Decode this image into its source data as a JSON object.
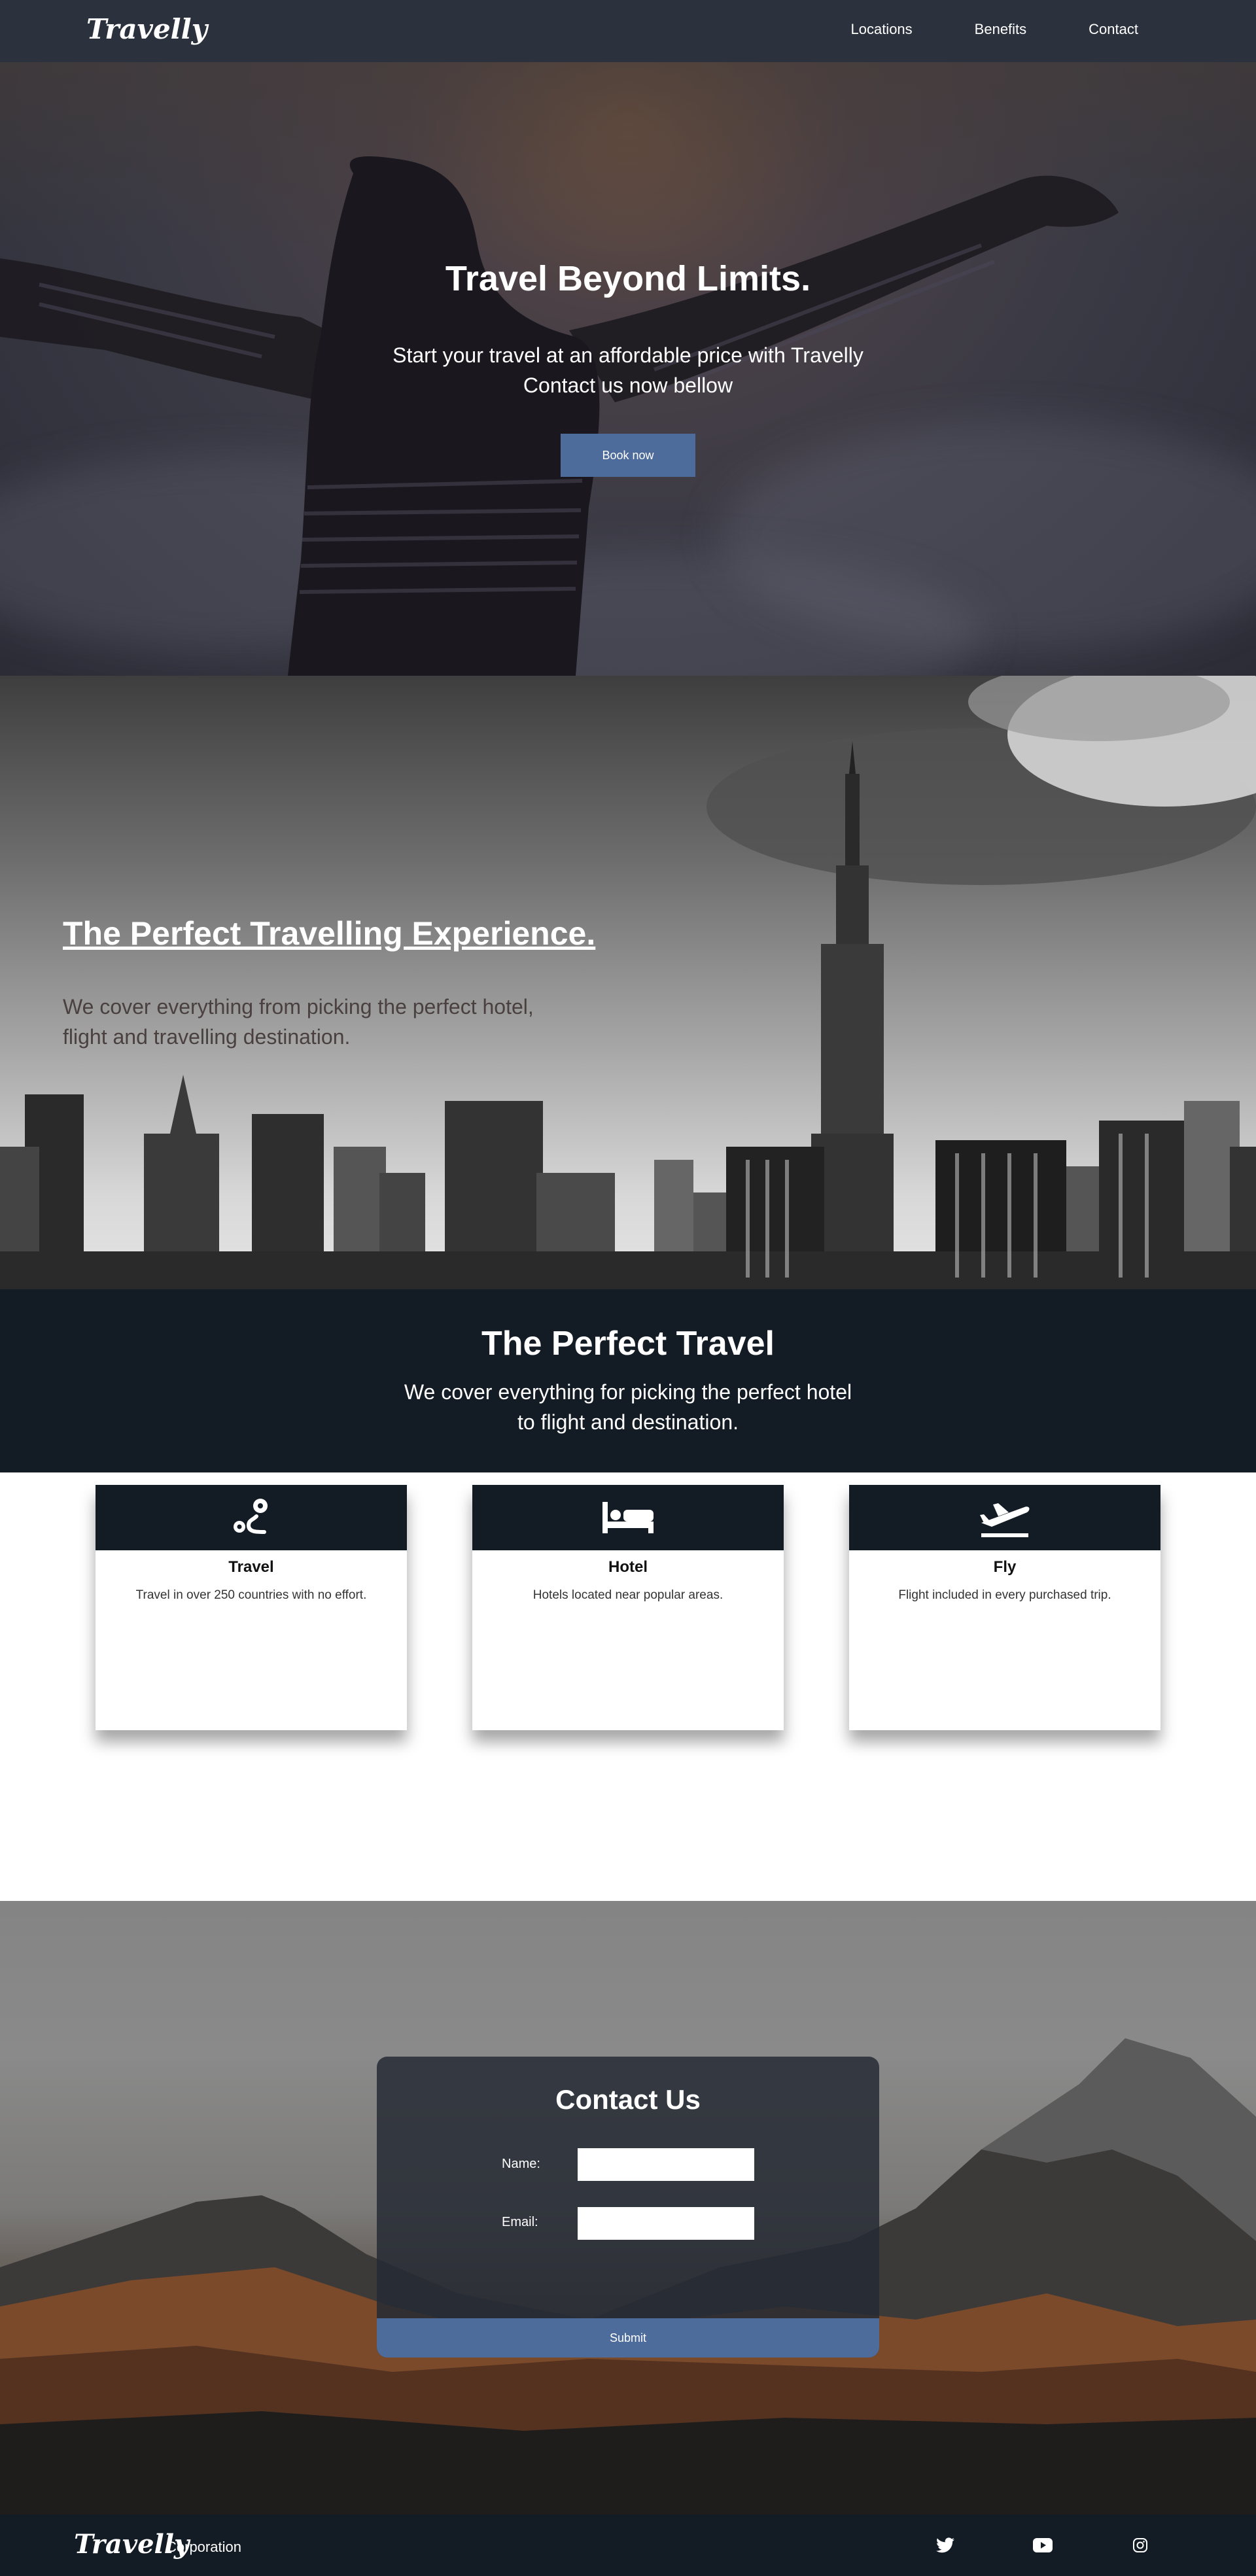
{
  "nav": {
    "logo": "Travelly",
    "links": [
      "Locations",
      "Benefits",
      "Contact"
    ]
  },
  "hero": {
    "title": "Travel Beyond Limits.",
    "subtitle_line1": "Start your travel at an affordable price with Travelly",
    "subtitle_line2": "Contact us now bellow",
    "button": "Book now"
  },
  "city": {
    "title": "The Perfect Travelling Experience.",
    "subtitle_line1": "We cover everything from picking the perfect hotel,",
    "subtitle_line2": "flight and travelling destination."
  },
  "perfect_travel": {
    "title": "The Perfect Travel",
    "subtitle_line1": "We cover everything for picking the perfect hotel",
    "subtitle_line2": "to flight and destination."
  },
  "cards": [
    {
      "icon": "route-icon",
      "title": "Travel",
      "desc": "Travel in over 250 countries with no effort."
    },
    {
      "icon": "bed-icon",
      "title": "Hotel",
      "desc": "Hotels located near popular areas."
    },
    {
      "icon": "plane-departure-icon",
      "title": "Fly",
      "desc": "Flight included in every purchased trip."
    }
  ],
  "contact": {
    "title": "Contact Us",
    "name_label": "Name:",
    "email_label": "Email:",
    "submit": "Submit"
  },
  "footer": {
    "logo": "Travelly",
    "corp": "Corporation",
    "social": [
      "twitter-icon",
      "youtube-icon",
      "instagram-icon"
    ]
  },
  "colors": {
    "nav_bg": "#2b313d",
    "accent": "#4d6b9b",
    "dark": "#131b24"
  }
}
